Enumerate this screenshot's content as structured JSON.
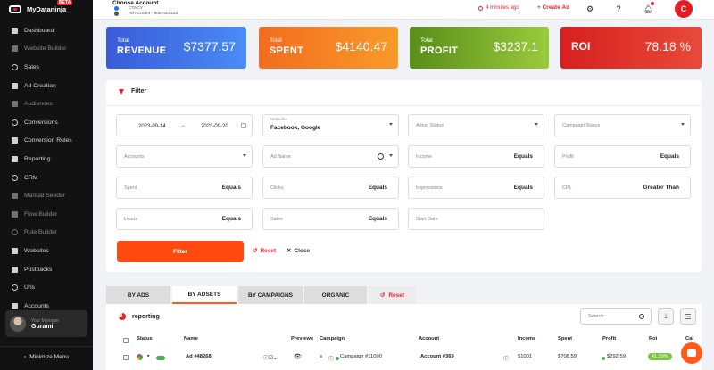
{
  "brand": {
    "name": "MyDataninja",
    "badge": "BETA"
  },
  "sidebar": {
    "items": [
      {
        "label": "Dashboard",
        "icon": "grid-icon",
        "dim": false
      },
      {
        "label": "Website Builder",
        "icon": "builder-icon",
        "dim": true
      },
      {
        "label": "Sales",
        "icon": "gauge-icon",
        "dim": false
      },
      {
        "label": "Ad Creation",
        "icon": "megaphone-icon",
        "dim": false
      },
      {
        "label": "Audiences",
        "icon": "audience-icon",
        "dim": true
      },
      {
        "label": "Conversions",
        "icon": "conversions-icon",
        "dim": false
      },
      {
        "label": "Conversion Rules",
        "icon": "rules-icon",
        "dim": false
      },
      {
        "label": "Reporting",
        "icon": "reporting-icon",
        "dim": false
      },
      {
        "label": "CRM",
        "icon": "crm-icon",
        "dim": false
      },
      {
        "label": "Manual Seeder",
        "icon": "seeder-icon",
        "dim": true
      },
      {
        "label": "Flow Builder",
        "icon": "flow-icon",
        "dim": true
      },
      {
        "label": "Rule Builder",
        "icon": "rule-builder-icon",
        "dim": true
      },
      {
        "label": "Websites",
        "icon": "globe-icon",
        "dim": false
      },
      {
        "label": "Postbacks",
        "icon": "anchor-icon",
        "dim": false
      },
      {
        "label": "Urls",
        "icon": "link-icon",
        "dim": false
      },
      {
        "label": "Accounts",
        "icon": "accounts-icon",
        "dim": false
      }
    ],
    "manager_label": "Your Manager",
    "manager_name": "Gurami",
    "minimize_label": "Minimize Menu"
  },
  "topbar": {
    "account_title": "Choose Account",
    "account_line1": "CTACY",
    "account_line2": "Ad Account - 5087601533",
    "updated": "4 minutes ago",
    "create_ad": "+ Create Ad"
  },
  "stats": {
    "revenue": {
      "l1": "Total",
      "l2": "REVENUE",
      "value": "$7377.57"
    },
    "spent": {
      "l1": "Total",
      "l2": "SPENT",
      "value": "$4140.47"
    },
    "profit": {
      "l1": "Total",
      "l2": "PROFIT",
      "value": "$3237.1"
    },
    "roi": {
      "label": "ROI",
      "value": "78.18 %"
    }
  },
  "filter": {
    "title": "Filter",
    "date_from": "2023-09-14",
    "date_to": "2023-09-20",
    "networks_label": "Networks",
    "networks_value": "Facebook, Google",
    "adset_status": "Adset Status",
    "campaign_status": "Campaign Status",
    "accounts": "Accounts",
    "ad_name": "Ad Name",
    "income": "Income",
    "profit": "Profit",
    "spent": "Spent",
    "clicks": "Clicks",
    "impressions": "Impressions",
    "cpl": "CPL",
    "leads": "Leads",
    "sales": "Sales",
    "start_date": "Start Date",
    "equals": "Equals",
    "greater_than": "Greater Than",
    "filter_button": "Filter",
    "reset": "Reset",
    "close": "Close"
  },
  "tabs": [
    "BY ADS",
    "BY ADSETS",
    "BY CAMPAIGNS",
    "ORGANIC",
    "Reset"
  ],
  "reporting": {
    "title": "reporting",
    "search_placeholder": "Search",
    "columns": [
      "Status",
      "Name",
      "Previews",
      "Campaign",
      "Account",
      "Income",
      "Spent",
      "Profit",
      "Roi",
      "Cal"
    ],
    "row": {
      "name": "Ad #48268",
      "campaign": "Campaign #11090",
      "account": "Account #369",
      "income": "$1001",
      "spent": "$708.59",
      "profit": "$292.59",
      "roi": "41.29%"
    }
  },
  "colors": {
    "accent": "#ff4a0f",
    "revenue": "#3a5bd9",
    "spent": "#f26d1f",
    "profit": "#5a8d1a",
    "roi": "#d7201f"
  }
}
